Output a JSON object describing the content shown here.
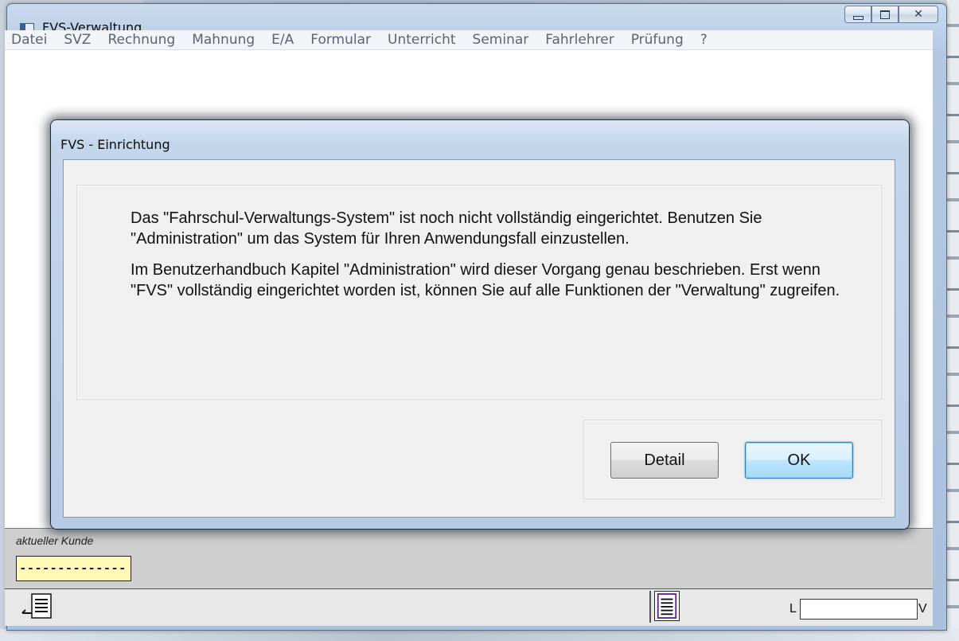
{
  "window": {
    "title": "FVS-Verwaltung"
  },
  "menu": {
    "items": [
      "Datei",
      "SVZ",
      "Rechnung",
      "Mahnung",
      "E/A",
      "Formular",
      "Unterricht",
      "Seminar",
      "Fahrlehrer",
      "Prüfung",
      "?"
    ]
  },
  "dialog": {
    "title": "FVS - Einrichtung",
    "paragraph1": "Das \"Fahrschul-Verwaltungs-System\" ist noch nicht vollständig eingerichtet. Benutzen Sie \"Administration\" um das System für Ihren Anwendungsfall einzustellen.",
    "paragraph2": "Im Benutzerhandbuch Kapitel \"Administration\" wird dieser Vorgang genau beschrieben. Erst wenn \"FVS\" vollständig eingerichtet worden ist, können Sie auf alle Funktionen der \"Verwaltung\" zugreifen.",
    "detail_label": "Detail",
    "ok_label": "OK"
  },
  "customer": {
    "label": "aktueller Kunde",
    "value": "--------------"
  },
  "status": {
    "l_label": "L",
    "v_label": "V",
    "field_value": ""
  },
  "colors": {
    "customer_field_bg": "#fff9b8",
    "ok_border": "#3c7fb1",
    "doc_icon_accent": "#5b2a86"
  }
}
